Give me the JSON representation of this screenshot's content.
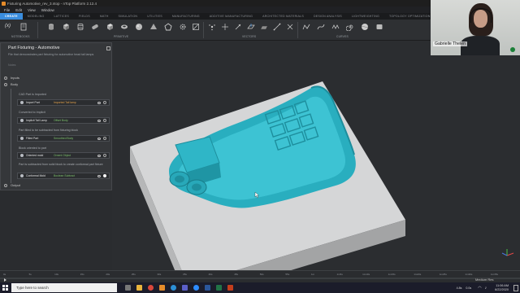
{
  "window": {
    "title": "Fixturing Automotive_rev_3.ntop - nTop Platform 2.12.4",
    "min_icon": "minimize-icon",
    "max_icon": "maximize-icon",
    "close_icon": "close-icon"
  },
  "menu": [
    "File",
    "Edit",
    "View",
    "Window"
  ],
  "tabs": [
    {
      "label": "CREATE",
      "active": true
    },
    {
      "label": "MODELING"
    },
    {
      "label": "LATTICES"
    },
    {
      "label": "FIELDS"
    },
    {
      "label": "MATH"
    },
    {
      "label": "SIMULATION"
    },
    {
      "label": "UTILITIES"
    },
    {
      "label": "MANUFACTURING"
    },
    {
      "label": "ADDITIVE MANUFACTURING"
    },
    {
      "label": "ARCHITECTED MATERIALS"
    },
    {
      "label": "DESIGN ANALYSIS"
    },
    {
      "label": "LIGHTWEIGHTING"
    },
    {
      "label": "TOPOLOGY OPTIMIZATION"
    }
  ],
  "ribbon": {
    "groups": [
      "NOTEBOOKS",
      "PRIMITIVE",
      "VECTORS",
      "CURVES"
    ],
    "fx_label": "(x)"
  },
  "panel": {
    "title": "Part Fixturing - Automotive",
    "description": "File that demonstrates part fixturing for automotive head tail lamps",
    "muted_text": "Notes",
    "sections": {
      "inputs": "Inputs",
      "body": "Body",
      "output": "Output"
    },
    "notes": [
      "CAD Part is Imported",
      "Converted to Implicit",
      "Part filled to be subtracted from fixturing block",
      "Block oriented to part",
      "Part is subtracted from solid block to create conformal part fixture"
    ],
    "steps": [
      {
        "name": "Import Part",
        "value": "Imported Tail lamp",
        "value_color": "orange"
      },
      {
        "name": "Implicit Tail Lamp",
        "value": "Offset Body",
        "value_color": "green"
      },
      {
        "name": "Filled Part",
        "value": "Smoothed Body",
        "value_color": "green"
      },
      {
        "name": "Oriented mold",
        "value": "Ornent Object",
        "value_color": "green"
      },
      {
        "name": "Conformal Mold",
        "value": "Boolean Subtract",
        "value_color": "green"
      }
    ]
  },
  "webcam": {
    "name": "Gabrielle Thelen"
  },
  "timeline": {
    "ticks": [
      "0s",
      "5s",
      "10s",
      "15s",
      "20s",
      "25s",
      "30s",
      "35s",
      "40s",
      "45s",
      "50s",
      "55s",
      "1m",
      "1m5s",
      "1m10s",
      "1m15s",
      "1m20s",
      "1m25s",
      "1m30s",
      "1m35s"
    ],
    "mode_label": "Medium Res"
  },
  "taskbar": {
    "search_placeholder": "Type here to search",
    "tray_a": "4.8s",
    "tray_b": "0.0s",
    "time": "11:06 AM",
    "date": "6/22/2020"
  },
  "colors": {
    "part": "#2fb3c6",
    "block_top": "#d9dadb",
    "block_side": "#a9aaab",
    "accent": "#3a8dde"
  }
}
